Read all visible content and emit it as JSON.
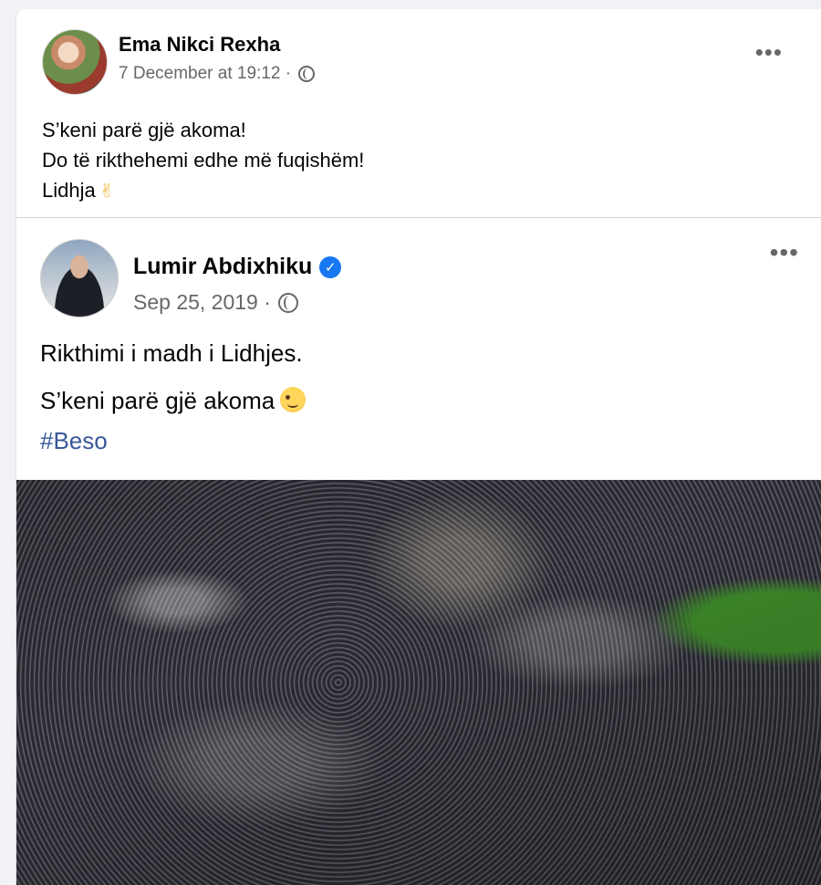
{
  "post": {
    "author": "Ema Nikci Rexha",
    "timestamp": "7 December at 19:12 ·",
    "privacy_icon": "globe-icon",
    "more_label": "•••",
    "lines": [
      "S’keni parë gjë akoma!",
      "Do të rikthehemi edhe më fuqishëm!",
      "Lidhja"
    ],
    "emoji_line3": "✌"
  },
  "shared_post": {
    "author": "Lumir Abdixhiku",
    "verified_mark": "✓",
    "timestamp": "Sep 25, 2019 ·",
    "privacy_icon": "globe-icon",
    "more_label": "•••",
    "line1": "Rikthimi i madh i Lidhjes.",
    "line2": "S’keni parë gjë akoma",
    "hashtag": "#Beso"
  },
  "colors": {
    "background": "#f0f2f5",
    "card": "#ffffff",
    "secondary_text": "#65676b",
    "hashtag": "#385898",
    "verified": "#1877f2"
  }
}
